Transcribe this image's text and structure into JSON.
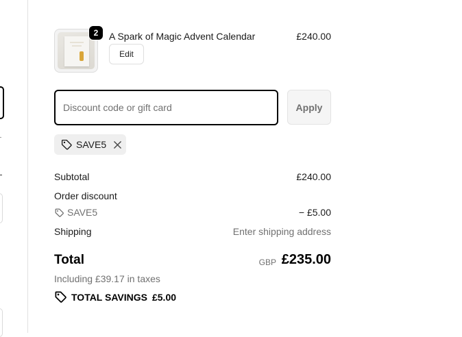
{
  "product": {
    "name": "A Spark of Magic Advent Calendar",
    "quantity": "2",
    "price": "£240.00",
    "edit_label": "Edit"
  },
  "discount": {
    "placeholder": "Discount code or gift card",
    "value": "",
    "apply_label": "Apply",
    "applied_code": "SAVE5"
  },
  "summary": {
    "subtotal_label": "Subtotal",
    "subtotal_value": "£240.00",
    "order_discount_label": "Order discount",
    "discount_code": "SAVE5",
    "discount_value": "− £5.00",
    "shipping_label": "Shipping",
    "shipping_value": "Enter shipping address",
    "total_label": "Total",
    "currency": "GBP",
    "total_value": "£235.00",
    "taxes_note": "Including £39.17 in taxes",
    "savings_label": "TOTAL SAVINGS",
    "savings_value": "£5.00"
  },
  "icons": {
    "tag": "tag-icon",
    "close": "close-icon",
    "savings": "savings-tag-icon"
  },
  "colors": {
    "text": "#1a1a1a",
    "muted": "#707070",
    "chip_bg": "#efefef",
    "border": "#dedede"
  }
}
